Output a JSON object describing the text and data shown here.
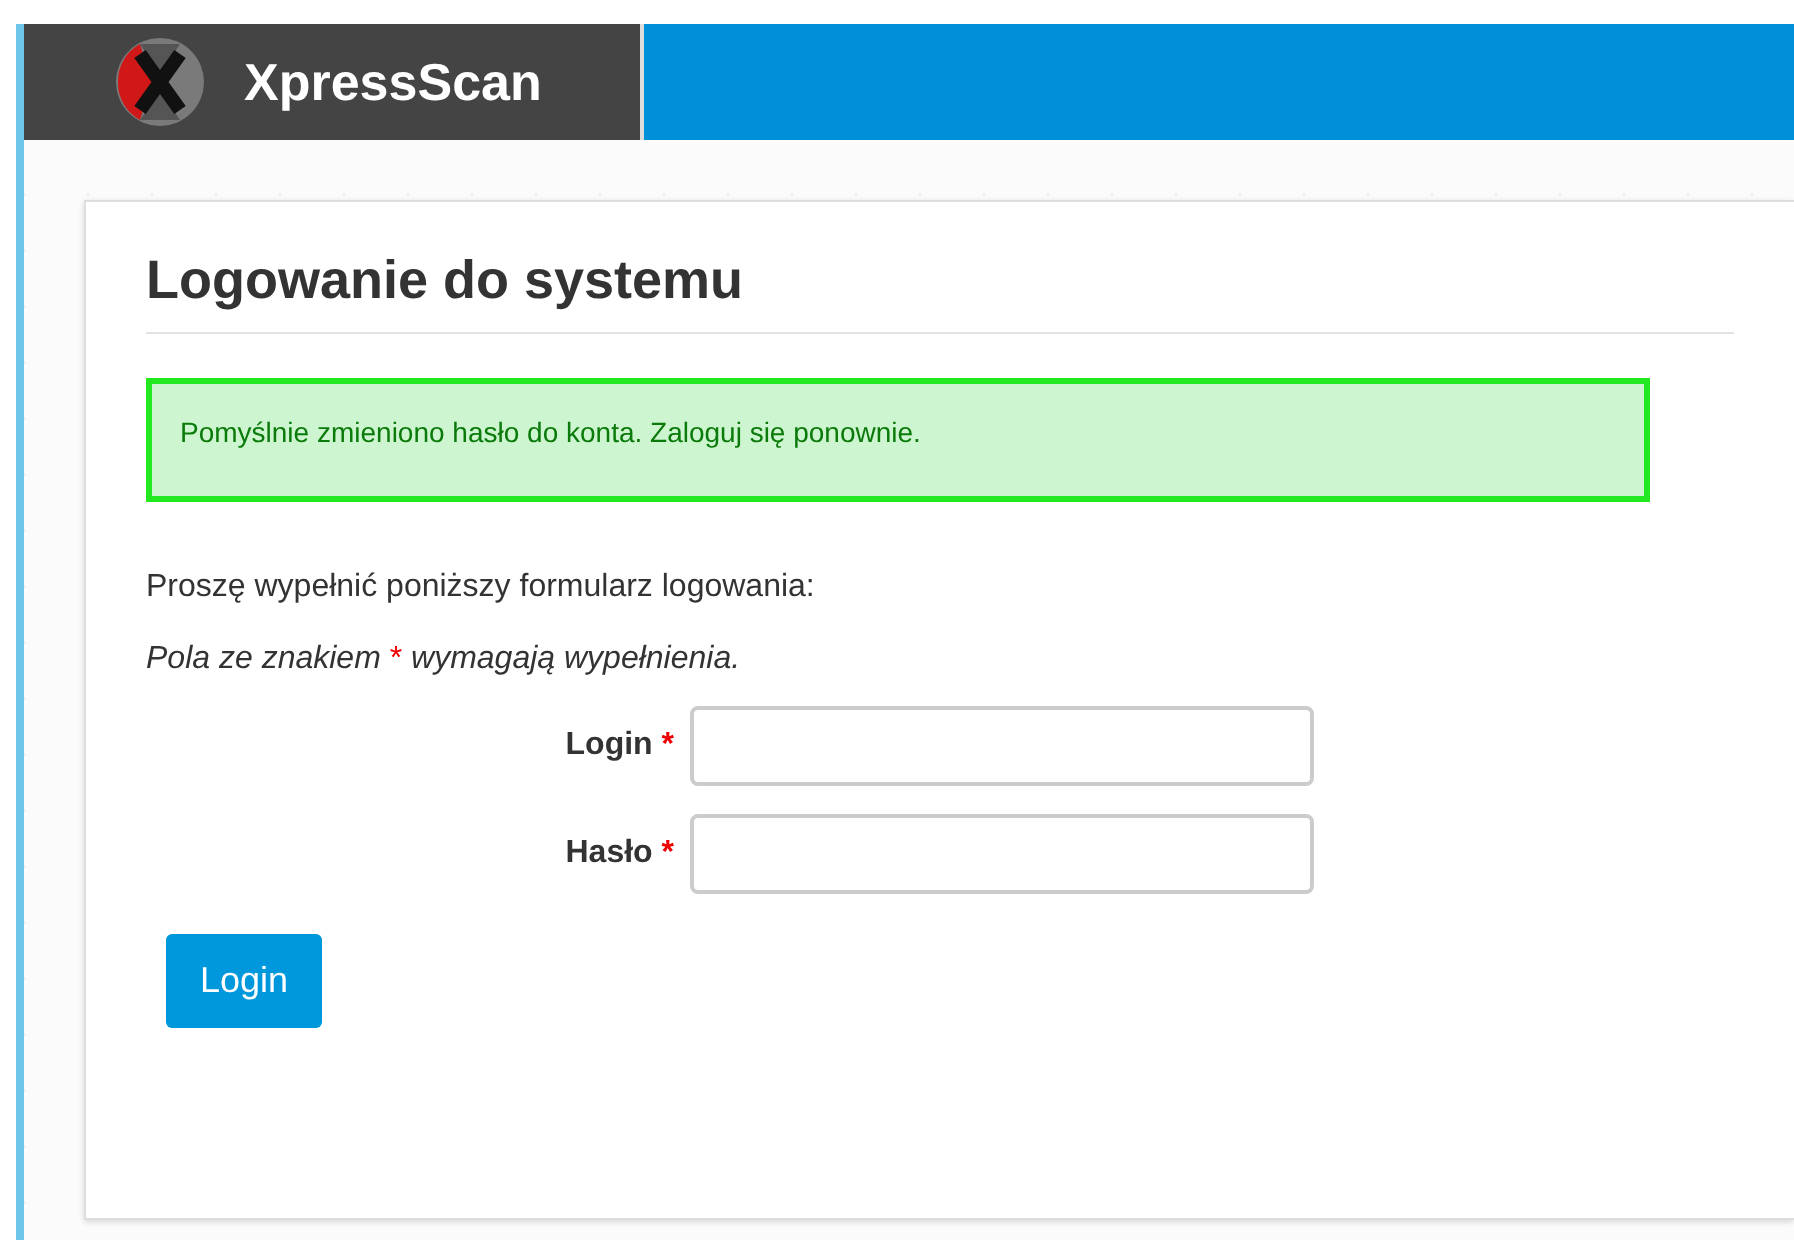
{
  "header": {
    "brand": "XpressScan"
  },
  "panel": {
    "title": "Logowanie do systemu",
    "alert": {
      "kind": "success",
      "text": "Pomyślnie zmieniono hasło do konta. Zaloguj się ponownie."
    },
    "intro": "Proszę wypełnić poniższy formularz logowania:",
    "note": {
      "before": "Pola ze znakiem ",
      "mark": "*",
      "after": " wymagają wypełnienia."
    },
    "fields": [
      {
        "label": "Login",
        "required_mark": "*"
      },
      {
        "label": "Hasło",
        "required_mark": "*"
      }
    ],
    "button": "Login"
  }
}
